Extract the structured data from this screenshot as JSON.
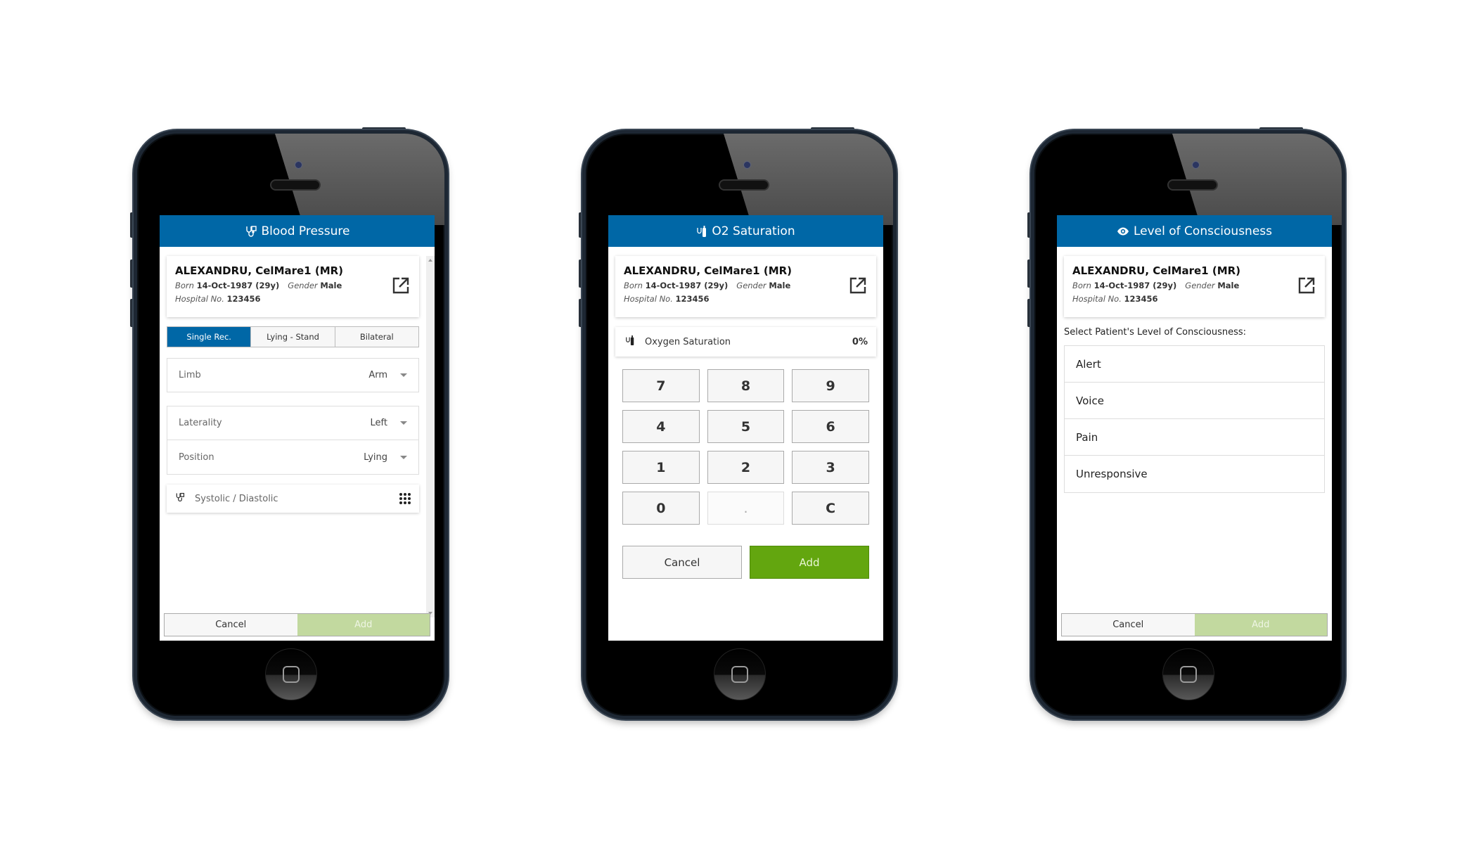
{
  "patient": {
    "name": "ALEXANDRU, CelMare1 (MR)",
    "born_label": "Born",
    "born_value": "14-Oct-1987 (29y)",
    "gender_label": "Gender",
    "gender_value": "Male",
    "hospital_label": "Hospital No.",
    "hospital_value": "123456",
    "open_icon": "open-in-new-icon"
  },
  "blood_pressure": {
    "title": "Blood Pressure",
    "title_icon": "stethoscope-icon",
    "modes": [
      {
        "label": "Single Rec.",
        "active": true
      },
      {
        "label": "Lying - Stand",
        "active": false
      },
      {
        "label": "Bilateral",
        "active": false
      }
    ],
    "fields": {
      "limb": {
        "label": "Limb",
        "value": "Arm"
      },
      "laterality": {
        "label": "Laterality",
        "value": "Left"
      },
      "position": {
        "label": "Position",
        "value": "Lying"
      }
    },
    "measure": {
      "label": "Systolic / Diastolic",
      "icon": "stethoscope-icon",
      "action_icon": "keypad-icon"
    },
    "cancel_label": "Cancel",
    "add_label": "Add"
  },
  "o2_saturation": {
    "title": "O2 Saturation",
    "title_icon": "oxygen-tank-icon",
    "row_label": "Oxygen Saturation",
    "row_value": "0%",
    "keys": [
      "7",
      "8",
      "9",
      "4",
      "5",
      "6",
      "1",
      "2",
      "3",
      "0",
      ".",
      "C"
    ],
    "cancel_label": "Cancel",
    "add_label": "Add"
  },
  "consciousness": {
    "title": "Level of Consciousness",
    "title_icon": "eye-icon",
    "prompt": "Select Patient's Level of Consciousness:",
    "options": [
      "Alert",
      "Voice",
      "Pain",
      "Unresponsive"
    ],
    "cancel_label": "Cancel",
    "add_label": "Add"
  },
  "colors": {
    "header": "#0067a6",
    "add_disabled": "#c2d99f",
    "add_enabled": "#63a60f"
  }
}
